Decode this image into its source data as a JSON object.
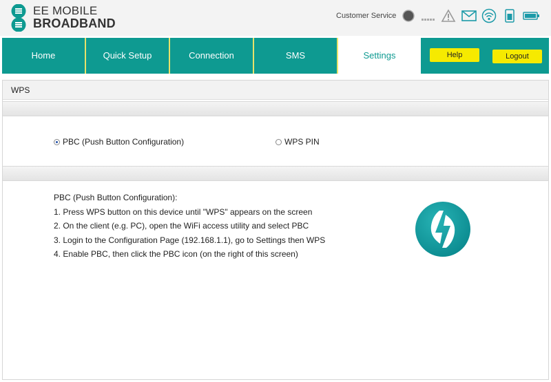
{
  "brand": {
    "line1": "EE MOBILE",
    "line2": "BROADBAND"
  },
  "header": {
    "customer_service": "Customer Service",
    "status_icons": [
      "status-indicator-icon",
      "signal-strength-icon",
      "warning-icon",
      "mail-icon",
      "wifi-icon",
      "sim-icon",
      "battery-icon"
    ]
  },
  "nav": {
    "tabs": [
      {
        "label": "Home"
      },
      {
        "label": "Quick Setup"
      },
      {
        "label": "Connection"
      },
      {
        "label": "SMS"
      },
      {
        "label": "Settings",
        "active": true
      }
    ],
    "help_label": "Help",
    "logout_label": "Logout"
  },
  "page": {
    "title": "WPS",
    "options": [
      {
        "label": "PBC (Push Button Configuration)",
        "selected": true
      },
      {
        "label": "WPS PIN",
        "selected": false
      }
    ],
    "instructions": {
      "heading": "PBC (Push Button Configuration):",
      "steps": [
        "1. Press WPS button on this device until \"WPS\" appears on the screen",
        "2. On the client (e.g. PC), open the WiFi access utility and select PBC",
        "3. Login to the Configuration Page (192.168.1.1), go to Settings then WPS",
        "4. Enable PBC, then click the PBC icon (on the right of this screen)"
      ]
    }
  },
  "colors": {
    "teal": "#0e9a91",
    "yellow": "#f6ea00",
    "tab_separator": "#e8e26a"
  }
}
